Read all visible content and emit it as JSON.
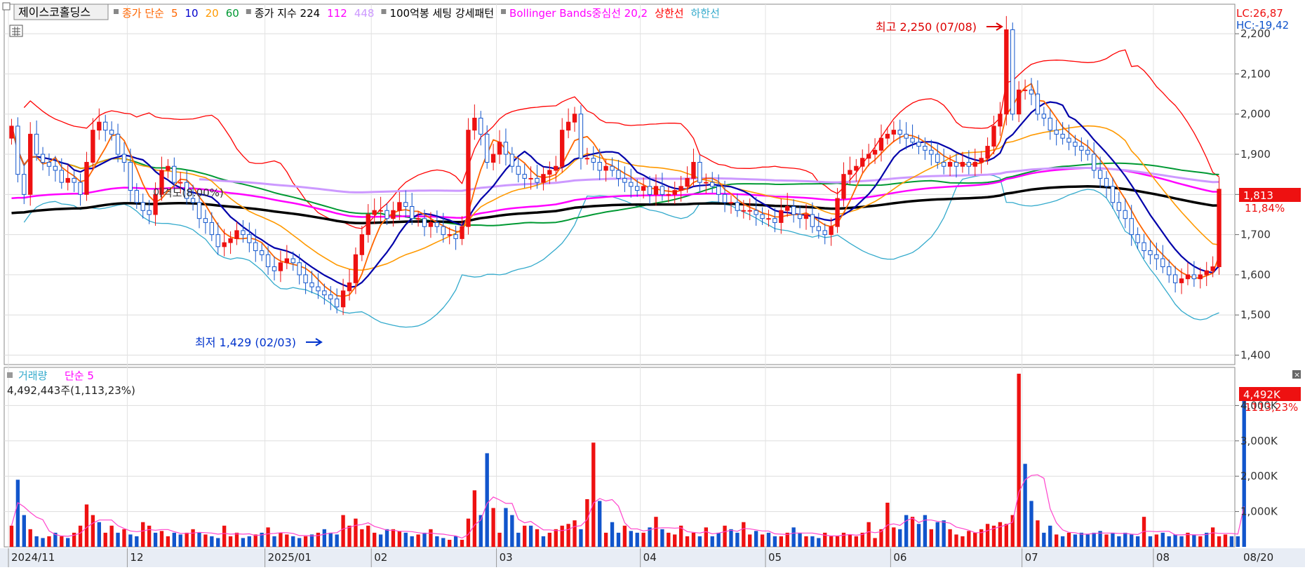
{
  "header": {
    "stock_name": "제이스코홀딩스",
    "items": [
      {
        "text": "종가 단순",
        "color": "#ff6600"
      },
      {
        "text": "5",
        "color": "#ff6600"
      },
      {
        "text": "10",
        "color": "#0000cc"
      },
      {
        "text": "20",
        "color": "#ff9900"
      },
      {
        "text": "60",
        "color": "#009933"
      },
      {
        "text": "종가 지수 224",
        "color": "#000000"
      },
      {
        "text": "112",
        "color": "#ff00ff"
      },
      {
        "text": "448",
        "color": "#cc99ff"
      },
      {
        "text": "100억봉 세팅 강세패턴",
        "color": "#000000"
      },
      {
        "text": "Bollinger Bands중심선 20,2",
        "color": "#ff00ff"
      },
      {
        "text": "상한선",
        "color": "#ff0000"
      },
      {
        "text": "하한선",
        "color": "#33aacc"
      }
    ],
    "lc": "LC:26,87",
    "hc": "HC:-19,42"
  },
  "chart_data": [
    {
      "type": "candlestick",
      "panel": "price",
      "ylim": [
        1380,
        2270
      ],
      "yticks": [
        "2,200",
        "2,100",
        "2,000",
        "1,900",
        "1,800",
        "1,700",
        "1,600",
        "1,500",
        "1,400"
      ],
      "ytick_values": [
        2200,
        2100,
        2000,
        1900,
        1800,
        1700,
        1600,
        1500,
        1400
      ],
      "current_price": "1,813",
      "current_change": "11,84%",
      "annotation_high": "최고 2,250 (07/08)",
      "annotation_low": "최저 1,429 (02/03)",
      "annotation_disparity": "이격도(8.00%)",
      "close": [
        1970,
        1850,
        1800,
        1950,
        1900,
        1880,
        1870,
        1860,
        1830,
        1840,
        1830,
        1800,
        1880,
        1960,
        1980,
        1960,
        1950,
        1900,
        1880,
        1810,
        1780,
        1760,
        1750,
        1800,
        1860,
        1870,
        1830,
        1830,
        1790,
        1780,
        1740,
        1730,
        1700,
        1670,
        1680,
        1690,
        1710,
        1700,
        1680,
        1660,
        1650,
        1620,
        1610,
        1630,
        1640,
        1630,
        1600,
        1580,
        1570,
        1560,
        1550,
        1540,
        1520,
        1560,
        1580,
        1650,
        1700,
        1750,
        1760,
        1760,
        1740,
        1760,
        1780,
        1770,
        1740,
        1740,
        1720,
        1730,
        1720,
        1700,
        1700,
        1690,
        1720,
        1960,
        1990,
        1950,
        1880,
        1900,
        1930,
        1900,
        1870,
        1850,
        1840,
        1840,
        1830,
        1850,
        1860,
        1870,
        1960,
        1980,
        2000,
        1890,
        1890,
        1880,
        1860,
        1870,
        1860,
        1840,
        1830,
        1820,
        1810,
        1820,
        1800,
        1820,
        1800,
        1800,
        1810,
        1820,
        1840,
        1880,
        1830,
        1830,
        1820,
        1800,
        1780,
        1780,
        1760,
        1760,
        1760,
        1750,
        1740,
        1740,
        1730,
        1760,
        1770,
        1750,
        1740,
        1750,
        1720,
        1710,
        1700,
        1720,
        1790,
        1850,
        1860,
        1870,
        1890,
        1900,
        1910,
        1940,
        1950,
        1960,
        1950,
        1940,
        1930,
        1920,
        1910,
        1900,
        1880,
        1870,
        1880,
        1870,
        1880,
        1870,
        1880,
        1890,
        1920,
        1970,
        2000,
        2210,
        2000,
        2060,
        2060,
        2050,
        2000,
        1990,
        1960,
        1950,
        1940,
        1930,
        1920,
        1910,
        1900,
        1860,
        1840,
        1820,
        1780,
        1760,
        1740,
        1700,
        1680,
        1660,
        1650,
        1640,
        1620,
        1600,
        1580,
        1590,
        1600,
        1590,
        1600,
        1610,
        1620,
        1813
      ],
      "trend": "declining from 1,970 to 1,540 low (02/03), rally to 2,000 in 03, consolidation 1,740-1,860 through 06, spike to 2,250 (07/08), decline to ~1,560 in 08, final day surge to 1,813"
    },
    {
      "type": "bar",
      "panel": "volume",
      "ylim": [
        0,
        5000
      ],
      "yticks": [
        "4,000K",
        "3,000K",
        "2,000K",
        "1,000K"
      ],
      "ytick_values": [
        4000,
        3000,
        2000,
        1000
      ],
      "unit": "K",
      "title": "거래량",
      "ma_label": "단순 5",
      "latest_label": "4,492,443주(1,113,23%)",
      "latest_value": "4,492K",
      "latest_pct": "1113,23%",
      "values": [
        600,
        1900,
        900,
        500,
        300,
        250,
        300,
        400,
        300,
        250,
        400,
        600,
        1200,
        900,
        700,
        400,
        600,
        400,
        500,
        350,
        300,
        700,
        600,
        400,
        450,
        300,
        400,
        350,
        400,
        500,
        400,
        350,
        300,
        250,
        600,
        300,
        400,
        250,
        300,
        350,
        400,
        550,
        300,
        400,
        350,
        300,
        250,
        300,
        350,
        400,
        500,
        400,
        350,
        900,
        600,
        800,
        500,
        600,
        400,
        350,
        500,
        500,
        450,
        400,
        300,
        350,
        400,
        500,
        300,
        250,
        200,
        300,
        200,
        800,
        1600,
        900,
        2650,
        1100,
        400,
        1100,
        900,
        400,
        600,
        600,
        500,
        300,
        400,
        500,
        600,
        650,
        750,
        500,
        1350,
        2950,
        1300,
        400,
        700,
        400,
        600,
        450,
        400,
        400,
        550,
        850,
        500,
        400,
        350,
        600,
        300,
        400,
        300,
        550,
        300,
        400,
        600,
        500,
        400,
        700,
        350,
        450,
        350,
        400,
        300,
        300,
        400,
        550,
        400,
        300,
        300,
        250,
        400,
        300,
        300,
        400,
        350,
        300,
        400,
        700,
        250,
        500,
        1250,
        550,
        500,
        900,
        850,
        650,
        900,
        500,
        700,
        750,
        500,
        350,
        300,
        450,
        400,
        500,
        650,
        600,
        700,
        650,
        900,
        4900,
        2350,
        1300,
        750,
        400,
        600,
        350,
        300,
        400,
        350,
        400,
        350,
        400,
        450,
        350,
        400,
        300,
        400,
        350,
        300,
        850,
        300,
        350,
        400,
        300,
        350,
        300,
        400,
        350,
        300,
        400,
        550,
        300,
        350,
        300,
        300,
        4492
      ],
      "up": [
        1,
        0,
        0,
        1,
        0,
        0,
        1,
        0,
        1,
        0,
        1,
        1,
        1,
        1,
        0,
        1,
        1,
        0,
        1,
        0,
        0,
        1,
        1,
        0,
        1,
        1,
        0,
        0,
        1,
        1,
        0,
        1,
        0,
        0,
        1,
        1,
        1,
        0,
        0,
        1,
        0,
        1,
        0,
        1,
        1,
        0,
        0,
        1,
        0,
        1,
        0,
        0,
        0,
        1,
        1,
        1,
        1,
        1,
        1,
        0,
        0,
        1,
        1,
        0,
        0,
        1,
        0,
        1,
        0,
        0,
        1,
        0,
        1,
        1,
        1,
        0,
        0,
        1,
        1,
        0,
        0,
        0,
        1,
        0,
        1,
        0,
        1,
        1,
        1,
        1,
        1,
        0,
        1,
        1,
        0,
        1,
        0,
        0,
        1,
        0,
        0,
        1,
        0,
        1,
        0,
        1,
        1,
        1,
        1,
        1,
        0,
        1,
        0,
        0,
        1,
        0,
        0,
        1,
        1,
        0,
        1,
        0,
        0,
        1,
        1,
        0,
        0,
        1,
        0,
        0,
        1,
        1,
        1,
        1,
        1,
        1,
        1,
        1,
        1,
        1,
        1,
        1,
        0,
        0,
        1,
        0,
        0,
        1,
        0,
        0,
        1,
        1,
        1,
        1,
        1,
        1,
        1,
        1,
        1,
        1,
        1,
        1,
        0,
        0,
        1,
        0,
        0,
        1,
        0,
        1,
        0,
        0,
        0,
        0,
        0,
        1,
        0,
        0,
        0,
        0,
        0,
        1,
        0,
        1,
        0,
        0,
        0,
        0,
        1,
        0,
        1,
        0,
        1,
        1,
        1
      ]
    }
  ],
  "x_axis": {
    "labels": [
      "2024/11",
      "12",
      "2025/01",
      "02",
      "03",
      "04",
      "05",
      "06",
      "07",
      "08"
    ],
    "last_date": "08/20"
  },
  "colors": {
    "up": "#ee1111",
    "down": "#1155cc",
    "ma5": "#ff6600",
    "ma10": "#0000aa",
    "ma20": "#ff9900",
    "ma60": "#009933",
    "ema224": "#000000",
    "ema112": "#ff00ff",
    "ema448": "#cc99ff",
    "bb_upper": "#ff0000",
    "bb_lower": "#33aacc",
    "volume_ma": "#ff44cc"
  }
}
